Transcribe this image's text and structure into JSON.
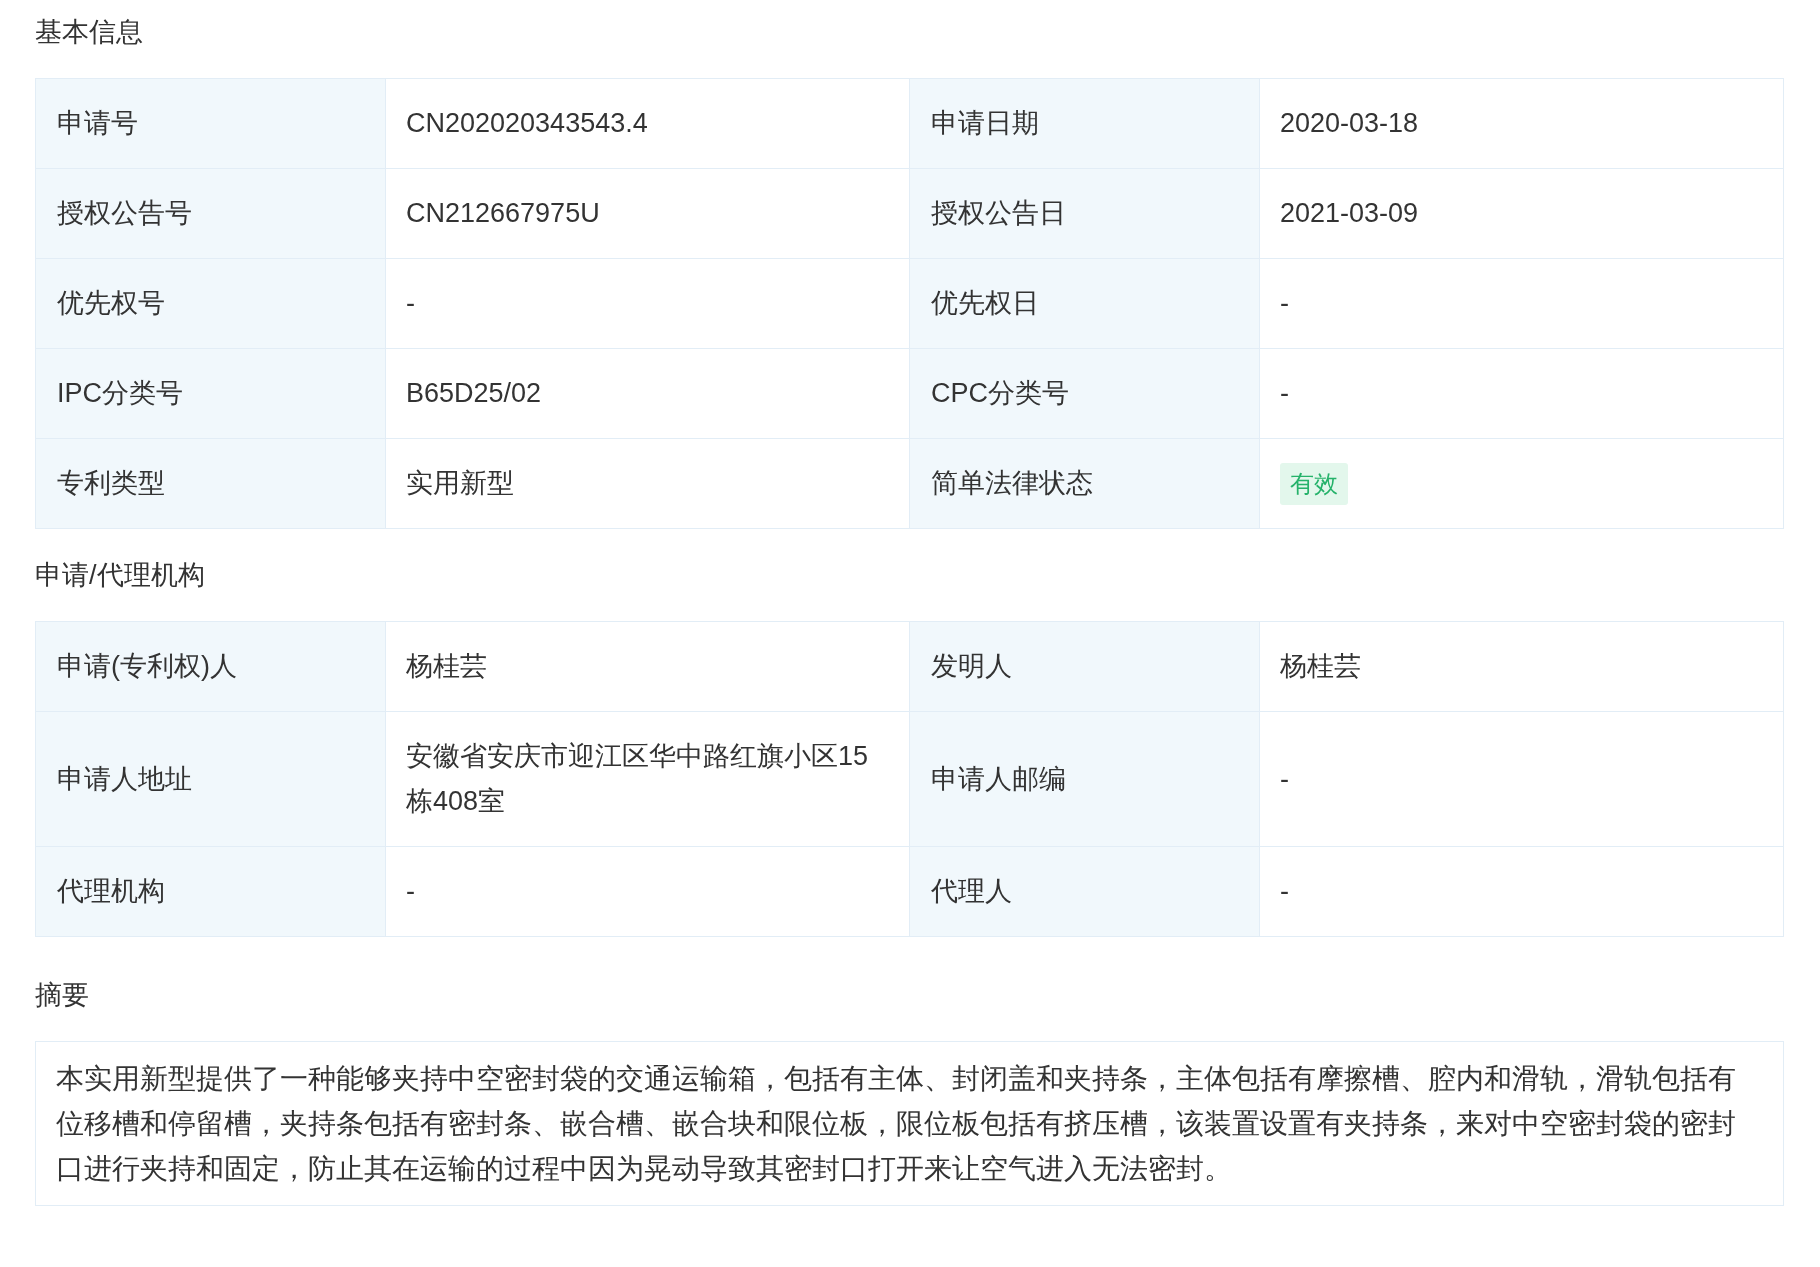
{
  "sections": [
    {
      "title": "基本信息",
      "rows": [
        [
          {
            "label": "申请号",
            "value": "CN202020343543.4",
            "kind": "text"
          },
          {
            "label": "申请日期",
            "value": "2020-03-18",
            "kind": "text"
          }
        ],
        [
          {
            "label": "授权公告号",
            "value": "CN212667975U",
            "kind": "text"
          },
          {
            "label": "授权公告日",
            "value": "2021-03-09",
            "kind": "text"
          }
        ],
        [
          {
            "label": "优先权号",
            "value": "-",
            "kind": "text"
          },
          {
            "label": "优先权日",
            "value": "-",
            "kind": "text"
          }
        ],
        [
          {
            "label": "IPC分类号",
            "value": "B65D25/02",
            "kind": "text"
          },
          {
            "label": "CPC分类号",
            "value": "-",
            "kind": "text"
          }
        ],
        [
          {
            "label": "专利类型",
            "value": "实用新型",
            "kind": "text"
          },
          {
            "label": "简单法律状态",
            "value": "有效",
            "kind": "badge"
          }
        ]
      ]
    },
    {
      "title": "申请/代理机构",
      "rows": [
        [
          {
            "label": "申请(专利权)人",
            "value": "杨桂芸",
            "kind": "text"
          },
          {
            "label": "发明人",
            "value": "杨桂芸",
            "kind": "text"
          }
        ],
        [
          {
            "label": "申请人地址",
            "value": "安徽省安庆市迎江区华中路红旗小区15栋408室",
            "kind": "text"
          },
          {
            "label": "申请人邮编",
            "value": "-",
            "kind": "text"
          }
        ],
        [
          {
            "label": "代理机构",
            "value": "-",
            "kind": "text"
          },
          {
            "label": "代理人",
            "value": "-",
            "kind": "text"
          }
        ]
      ]
    }
  ],
  "abstract": {
    "title": "摘要",
    "text": "本实用新型提供了一种能够夹持中空密封袋的交通运输箱，包括有主体、封闭盖和夹持条，主体包括有摩擦槽、腔内和滑轨，滑轨包括有位移槽和停留槽，夹持条包括有密封条、嵌合槽、嵌合块和限位板，限位板包括有挤压槽，该装置设置有夹持条，来对中空密封袋的密封口进行夹持和固定，防止其在运输的过程中因为晃动导致其密封口打开来让空气进入无法密封。"
  }
}
